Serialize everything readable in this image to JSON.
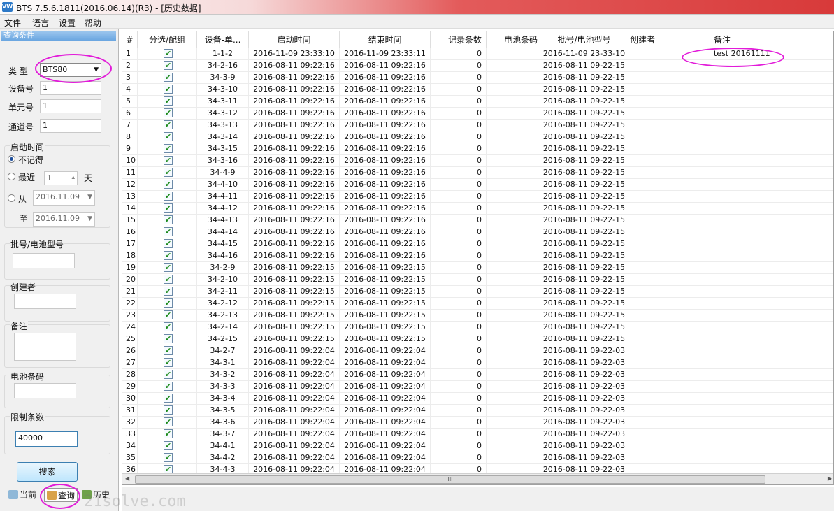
{
  "window": {
    "title": "BTS 7.5.6.1811(2016.06.14)(R3) - [历史数据]",
    "icon": "app-icon"
  },
  "menu": [
    "文件",
    "语言",
    "设置",
    "帮助"
  ],
  "sidebar": {
    "header": "查询条件",
    "type_label": "类  型",
    "type_value": "BTS80",
    "device_label": "设备号",
    "device_value": "1",
    "unit_label": "单元号",
    "unit_value": "1",
    "channel_label": "通道号",
    "channel_value": "1",
    "start_time_label": "启动时间",
    "radio_no_record": "不记得",
    "radio_recent": "最近",
    "recent_value": "1",
    "recent_unit": "天",
    "radio_from": "从",
    "from_date": "2016.11.09",
    "to_label": "至",
    "to_date": "2016.11.09",
    "batch_label": "批号/电池型号",
    "creator_label": "创建者",
    "remark_label": "备注",
    "barcode_label": "电池条码",
    "limit_label": "限制条数",
    "limit_value": "40000",
    "search_button": "搜索",
    "tabs": [
      "当前",
      "查询",
      "历史"
    ]
  },
  "grid": {
    "columns": [
      "#",
      "分选/配组",
      "设备-单...",
      "启动时间",
      "结束时间",
      "记录条数",
      "电池条码",
      "批号/电池型号",
      "创建者",
      "备注"
    ],
    "rows": [
      [
        "1",
        "1-1-2",
        "2016-11-09 23:33:10",
        "2016-11-09 23:33:11",
        "0",
        "2016-11-09 23-33-10",
        "test 20161111"
      ],
      [
        "2",
        "34-2-16",
        "2016-08-11 09:22:16",
        "2016-08-11 09:22:16",
        "0",
        "2016-08-11 09-22-15",
        ""
      ],
      [
        "3",
        "34-3-9",
        "2016-08-11 09:22:16",
        "2016-08-11 09:22:16",
        "0",
        "2016-08-11 09-22-15",
        ""
      ],
      [
        "4",
        "34-3-10",
        "2016-08-11 09:22:16",
        "2016-08-11 09:22:16",
        "0",
        "2016-08-11 09-22-15",
        ""
      ],
      [
        "5",
        "34-3-11",
        "2016-08-11 09:22:16",
        "2016-08-11 09:22:16",
        "0",
        "2016-08-11 09-22-15",
        ""
      ],
      [
        "6",
        "34-3-12",
        "2016-08-11 09:22:16",
        "2016-08-11 09:22:16",
        "0",
        "2016-08-11 09-22-15",
        ""
      ],
      [
        "7",
        "34-3-13",
        "2016-08-11 09:22:16",
        "2016-08-11 09:22:16",
        "0",
        "2016-08-11 09-22-15",
        ""
      ],
      [
        "8",
        "34-3-14",
        "2016-08-11 09:22:16",
        "2016-08-11 09:22:16",
        "0",
        "2016-08-11 09-22-15",
        ""
      ],
      [
        "9",
        "34-3-15",
        "2016-08-11 09:22:16",
        "2016-08-11 09:22:16",
        "0",
        "2016-08-11 09-22-15",
        ""
      ],
      [
        "10",
        "34-3-16",
        "2016-08-11 09:22:16",
        "2016-08-11 09:22:16",
        "0",
        "2016-08-11 09-22-15",
        ""
      ],
      [
        "11",
        "34-4-9",
        "2016-08-11 09:22:16",
        "2016-08-11 09:22:16",
        "0",
        "2016-08-11 09-22-15",
        ""
      ],
      [
        "12",
        "34-4-10",
        "2016-08-11 09:22:16",
        "2016-08-11 09:22:16",
        "0",
        "2016-08-11 09-22-15",
        ""
      ],
      [
        "13",
        "34-4-11",
        "2016-08-11 09:22:16",
        "2016-08-11 09:22:16",
        "0",
        "2016-08-11 09-22-15",
        ""
      ],
      [
        "14",
        "34-4-12",
        "2016-08-11 09:22:16",
        "2016-08-11 09:22:16",
        "0",
        "2016-08-11 09-22-15",
        ""
      ],
      [
        "15",
        "34-4-13",
        "2016-08-11 09:22:16",
        "2016-08-11 09:22:16",
        "0",
        "2016-08-11 09-22-15",
        ""
      ],
      [
        "16",
        "34-4-14",
        "2016-08-11 09:22:16",
        "2016-08-11 09:22:16",
        "0",
        "2016-08-11 09-22-15",
        ""
      ],
      [
        "17",
        "34-4-15",
        "2016-08-11 09:22:16",
        "2016-08-11 09:22:16",
        "0",
        "2016-08-11 09-22-15",
        ""
      ],
      [
        "18",
        "34-4-16",
        "2016-08-11 09:22:16",
        "2016-08-11 09:22:16",
        "0",
        "2016-08-11 09-22-15",
        ""
      ],
      [
        "19",
        "34-2-9",
        "2016-08-11 09:22:15",
        "2016-08-11 09:22:15",
        "0",
        "2016-08-11 09-22-15",
        ""
      ],
      [
        "20",
        "34-2-10",
        "2016-08-11 09:22:15",
        "2016-08-11 09:22:15",
        "0",
        "2016-08-11 09-22-15",
        ""
      ],
      [
        "21",
        "34-2-11",
        "2016-08-11 09:22:15",
        "2016-08-11 09:22:15",
        "0",
        "2016-08-11 09-22-15",
        ""
      ],
      [
        "22",
        "34-2-12",
        "2016-08-11 09:22:15",
        "2016-08-11 09:22:15",
        "0",
        "2016-08-11 09-22-15",
        ""
      ],
      [
        "23",
        "34-2-13",
        "2016-08-11 09:22:15",
        "2016-08-11 09:22:15",
        "0",
        "2016-08-11 09-22-15",
        ""
      ],
      [
        "24",
        "34-2-14",
        "2016-08-11 09:22:15",
        "2016-08-11 09:22:15",
        "0",
        "2016-08-11 09-22-15",
        ""
      ],
      [
        "25",
        "34-2-15",
        "2016-08-11 09:22:15",
        "2016-08-11 09:22:15",
        "0",
        "2016-08-11 09-22-15",
        ""
      ],
      [
        "26",
        "34-2-7",
        "2016-08-11 09:22:04",
        "2016-08-11 09:22:04",
        "0",
        "2016-08-11 09-22-03",
        ""
      ],
      [
        "27",
        "34-3-1",
        "2016-08-11 09:22:04",
        "2016-08-11 09:22:04",
        "0",
        "2016-08-11 09-22-03",
        ""
      ],
      [
        "28",
        "34-3-2",
        "2016-08-11 09:22:04",
        "2016-08-11 09:22:04",
        "0",
        "2016-08-11 09-22-03",
        ""
      ],
      [
        "29",
        "34-3-3",
        "2016-08-11 09:22:04",
        "2016-08-11 09:22:04",
        "0",
        "2016-08-11 09-22-03",
        ""
      ],
      [
        "30",
        "34-3-4",
        "2016-08-11 09:22:04",
        "2016-08-11 09:22:04",
        "0",
        "2016-08-11 09-22-03",
        ""
      ],
      [
        "31",
        "34-3-5",
        "2016-08-11 09:22:04",
        "2016-08-11 09:22:04",
        "0",
        "2016-08-11 09-22-03",
        ""
      ],
      [
        "32",
        "34-3-6",
        "2016-08-11 09:22:04",
        "2016-08-11 09:22:04",
        "0",
        "2016-08-11 09-22-03",
        ""
      ],
      [
        "33",
        "34-3-7",
        "2016-08-11 09:22:04",
        "2016-08-11 09:22:04",
        "0",
        "2016-08-11 09-22-03",
        ""
      ],
      [
        "34",
        "34-4-1",
        "2016-08-11 09:22:04",
        "2016-08-11 09:22:04",
        "0",
        "2016-08-11 09-22-03",
        ""
      ],
      [
        "35",
        "34-4-2",
        "2016-08-11 09:22:04",
        "2016-08-11 09:22:04",
        "0",
        "2016-08-11 09-22-03",
        ""
      ],
      [
        "36",
        "34-4-3",
        "2016-08-11 09:22:04",
        "2016-08-11 09:22:04",
        "0",
        "2016-08-11 09-22-03",
        ""
      ]
    ],
    "scroll_thumb": "III"
  },
  "watermark": "21solve.com",
  "colors": {
    "highlight_ellipse": "#e21bd9",
    "title_gradient_end": "#d83a3a",
    "check": "#1c8a1c"
  }
}
